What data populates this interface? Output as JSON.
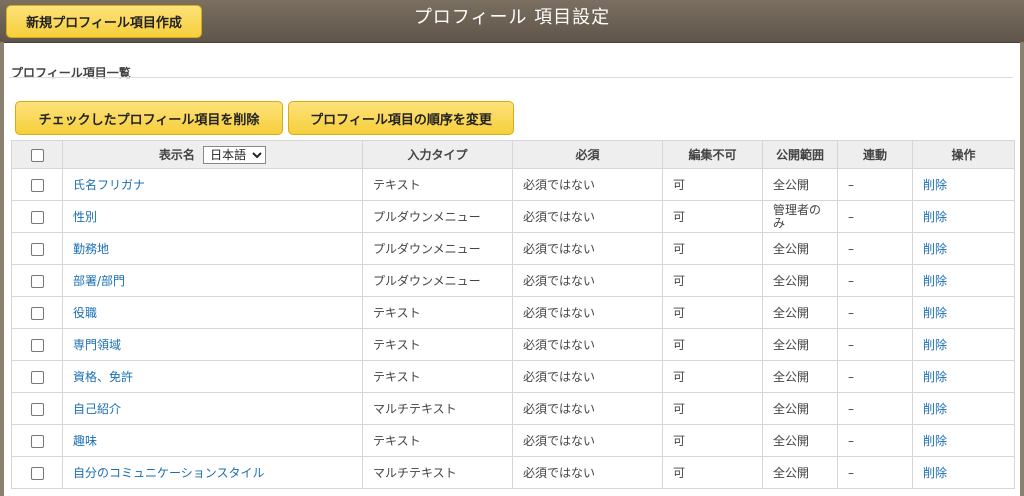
{
  "header": {
    "title": "プロフィール 項目設定",
    "new_button": "新規プロフィール項目作成"
  },
  "section": {
    "title": "プロフィール項目一覧"
  },
  "actions": {
    "delete_checked": "チェックしたプロフィール項目を削除",
    "change_order": "プロフィール項目の順序を変更"
  },
  "table": {
    "headers": {
      "display_name": "表示名",
      "language_selected": "日本語",
      "input_type": "入力タイプ",
      "required": "必須",
      "non_editable": "編集不可",
      "visibility": "公開範囲",
      "linked": "連動",
      "operation": "操作"
    },
    "rows": [
      {
        "name": "氏名フリガナ",
        "type": "テキスト",
        "required": "必須ではない",
        "editable": "可",
        "visibility": "全公開",
        "linked": "–",
        "op": "削除"
      },
      {
        "name": "性別",
        "type": "プルダウンメニュー",
        "required": "必須ではない",
        "editable": "可",
        "visibility": "管理者のみ",
        "linked": "–",
        "op": "削除"
      },
      {
        "name": "勤務地",
        "type": "プルダウンメニュー",
        "required": "必須ではない",
        "editable": "可",
        "visibility": "全公開",
        "linked": "–",
        "op": "削除"
      },
      {
        "name": "部署/部門",
        "type": "プルダウンメニュー",
        "required": "必須ではない",
        "editable": "可",
        "visibility": "全公開",
        "linked": "–",
        "op": "削除"
      },
      {
        "name": "役職",
        "type": "テキスト",
        "required": "必須ではない",
        "editable": "可",
        "visibility": "全公開",
        "linked": "–",
        "op": "削除"
      },
      {
        "name": "専門領域",
        "type": "テキスト",
        "required": "必須ではない",
        "editable": "可",
        "visibility": "全公開",
        "linked": "–",
        "op": "削除"
      },
      {
        "name": "資格、免許",
        "type": "テキスト",
        "required": "必須ではない",
        "editable": "可",
        "visibility": "全公開",
        "linked": "–",
        "op": "削除"
      },
      {
        "name": "自己紹介",
        "type": "マルチテキスト",
        "required": "必須ではない",
        "editable": "可",
        "visibility": "全公開",
        "linked": "–",
        "op": "削除"
      },
      {
        "name": "趣味",
        "type": "テキスト",
        "required": "必須ではない",
        "editable": "可",
        "visibility": "全公開",
        "linked": "–",
        "op": "削除"
      },
      {
        "name": "自分のコミュニケーションスタイル",
        "type": "マルチテキスト",
        "required": "必須ではない",
        "editable": "可",
        "visibility": "全公開",
        "linked": "–",
        "op": "削除"
      }
    ]
  },
  "colors": {
    "header_bg": "#6b6155",
    "button_yellow": "#f8d64e",
    "link": "#1a6fb3"
  }
}
